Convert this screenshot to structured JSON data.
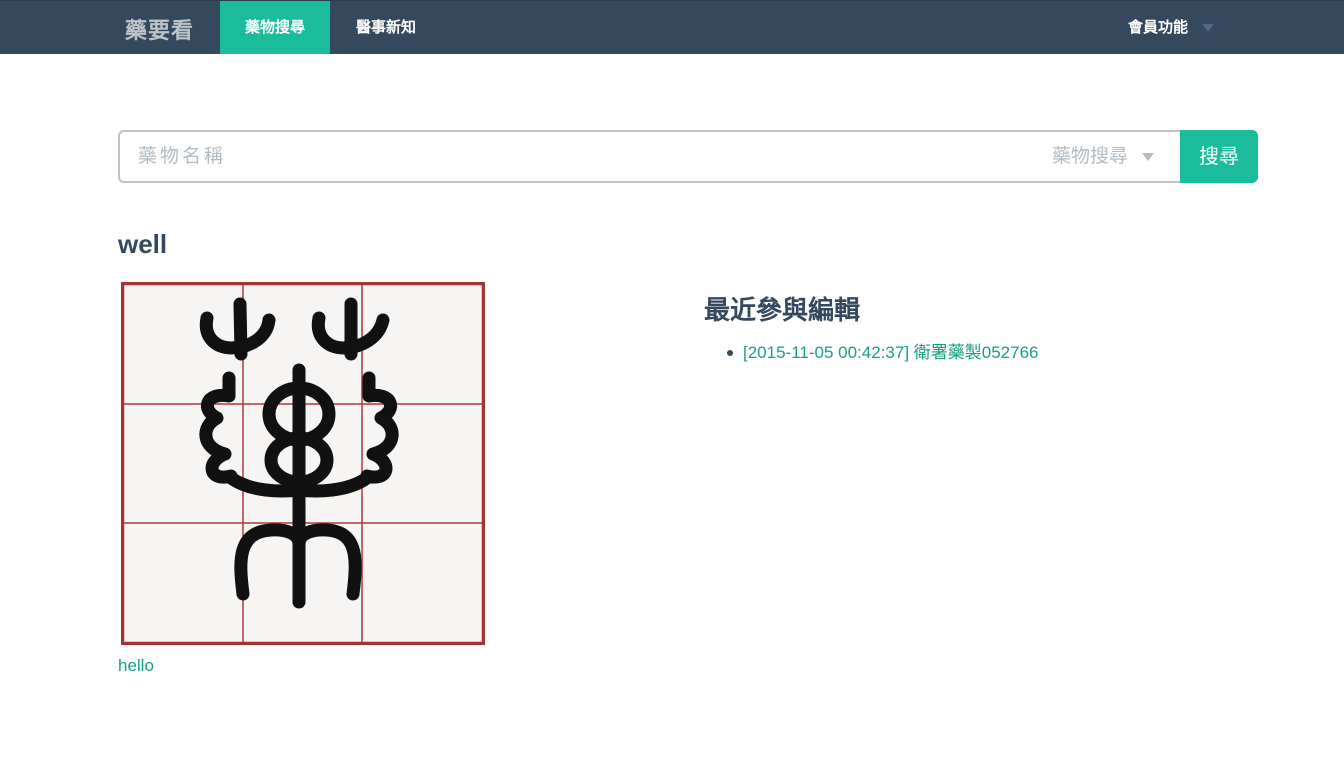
{
  "navbar": {
    "brand": "藥要看",
    "items": [
      {
        "label": "藥物搜尋",
        "active": true
      },
      {
        "label": "醫事新知",
        "active": false
      }
    ],
    "member_menu": "會員功能"
  },
  "search": {
    "placeholder": "藥物名稱",
    "value": "",
    "select_value": "藥物搜尋",
    "button_label": "搜尋"
  },
  "content": {
    "title": "well",
    "image_alt": "藥",
    "image_caption": "hello",
    "recent": {
      "heading": "最近參與編輯",
      "items": [
        "[2015-11-05 00:42:37] 衛署藥製052766"
      ]
    }
  },
  "colors": {
    "navbar_bg": "#34495e",
    "accent": "#1abc9c",
    "link": "#16a085",
    "heading": "#34495e",
    "grid_border": "#a83232",
    "paper": "#f7f5f3"
  },
  "icons": {
    "nav_caret": "caret-down-icon",
    "select_caret": "caret-down-icon",
    "list_bullet": "bullet-icon"
  }
}
